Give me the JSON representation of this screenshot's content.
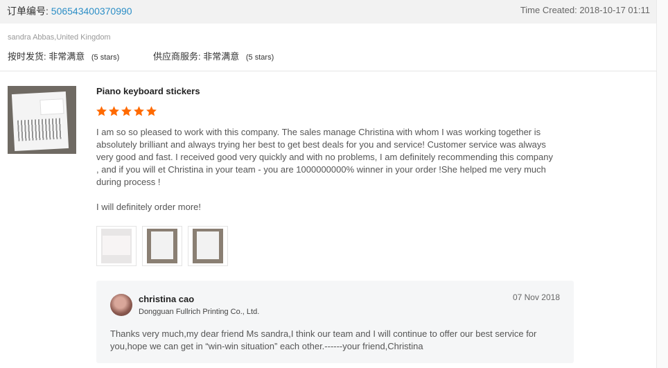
{
  "order": {
    "label": "订单编号:",
    "id": "506543400370990",
    "time_created": "Time Created: 2018-10-17 01:11"
  },
  "buyer": {
    "name_location": "sandra Abbas,United Kingdom",
    "delivery_label": "按时发货:",
    "delivery_value": "非常满意",
    "delivery_stars": "(5 stars)",
    "service_label": "供应商服务:",
    "service_value": "非常满意",
    "service_stars": "(5 stars)"
  },
  "product": {
    "title": "Piano keyboard stickers",
    "rating": 5,
    "star_color": "#ff6a00",
    "review_paragraphs": [
      "I am so so pleased to work with this company. The sales manage Christina with whom I was working together is absolutely brilliant and always trying her best to get best deals for you and service! Customer service was always very good and fast. I received good very quickly and with no problems, I am definitely recommending this company , and if you will et Christina in your team - you are 1000000000% winner in your order !She helped me very much during process !",
      "I will definitely order more!"
    ],
    "photos": [
      "review-photo-1",
      "review-photo-2",
      "review-photo-3"
    ]
  },
  "reply": {
    "author": "christina cao",
    "company": "Dongguan Fullrich Printing Co., Ltd.",
    "date": "07 Nov 2018",
    "text": "Thanks very much,my dear friend Ms sandra,I think our team and I will continue to offer our best service for you,hope we can get in “win-win situation” each other.------your friend,Christina"
  },
  "colors": {
    "link": "#2c8ec6",
    "header_bg": "#f2f2f2",
    "reply_bg": "#f5f6f7"
  }
}
